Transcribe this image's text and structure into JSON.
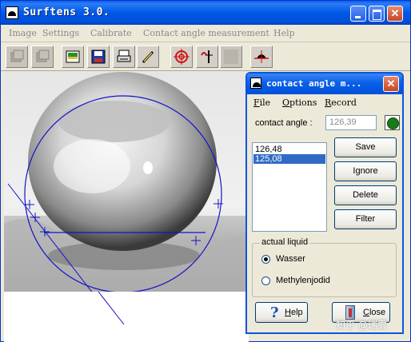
{
  "window": {
    "title": "Surftens 3.0."
  },
  "menu": [
    {
      "label": "Image"
    },
    {
      "label": "Settings"
    },
    {
      "label": "Calibrate"
    },
    {
      "label": "Contact angle measurement"
    },
    {
      "label": "Help"
    }
  ],
  "toolbar": {
    "buttons": [
      {
        "icon": "grab-icon",
        "enabled": false
      },
      {
        "icon": "snapshot-icon",
        "enabled": false
      },
      {
        "icon": "open-image-icon",
        "enabled": true
      },
      {
        "icon": "save-image-icon",
        "enabled": true
      },
      {
        "icon": "print-icon",
        "enabled": true
      },
      {
        "icon": "pen-icon",
        "enabled": true
      },
      {
        "icon": "crosshair-target-icon",
        "enabled": true
      },
      {
        "icon": "tangent-icon",
        "enabled": true
      },
      {
        "icon": "blank-icon",
        "enabled": false
      },
      {
        "icon": "drop-profile-icon",
        "enabled": true
      }
    ]
  },
  "dialog": {
    "title": "contact angle m...",
    "menu": [
      "File",
      "Options",
      "Record"
    ],
    "contact_angle_label": "contact angle :",
    "contact_angle_value": "126,39",
    "status_color": "#1a7a1a",
    "measurements": [
      {
        "value": "126,48",
        "selected": false
      },
      {
        "value": "125,08",
        "selected": true
      }
    ],
    "buttons": {
      "save": "Save",
      "ignore": "Ignore",
      "delete": "Delete",
      "filter": "Filter"
    },
    "liquid_group": {
      "label": "actual liquid",
      "options": [
        {
          "label": "Wasser",
          "checked": true
        },
        {
          "label": "Methylenjodid",
          "checked": false
        }
      ]
    },
    "help_label": "Help",
    "close_label": "Close"
  },
  "watermark": "知乎 @瑞雪",
  "colors": {
    "titlebar": "#0058e8",
    "fit_circle": "#1414c8",
    "selection": "#316ac5"
  }
}
